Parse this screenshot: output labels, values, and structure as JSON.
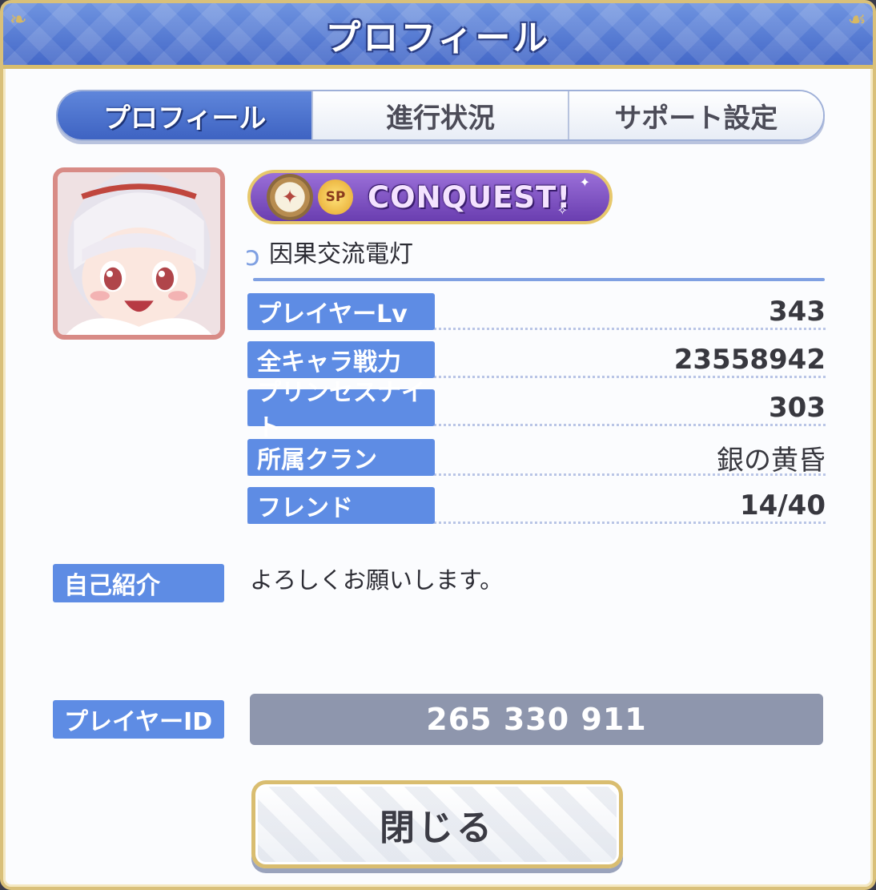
{
  "dialog": {
    "title": "プロフィール"
  },
  "tabs": [
    {
      "label": "プロフィール",
      "active": true
    },
    {
      "label": "進行状況",
      "active": false
    },
    {
      "label": "サポート設定",
      "active": false
    }
  ],
  "badge": {
    "sp_label": "SP",
    "text": "CONQUEST!"
  },
  "player": {
    "name": "因果交流電灯"
  },
  "stats": [
    {
      "label": "プレイヤーLv",
      "value": "343"
    },
    {
      "label": "全キャラ戦力",
      "value": "23558942"
    },
    {
      "label": "プリンセスナイト",
      "value": "303"
    },
    {
      "label": "所属クラン",
      "value": "銀の黄昏"
    },
    {
      "label": "フレンド",
      "value": "14/40"
    }
  ],
  "intro": {
    "label": "自己紹介",
    "text": "よろしくお願いします。"
  },
  "player_id": {
    "label": "プレイヤーID",
    "value": "265 330 911"
  },
  "close_button": {
    "label": "閉じる"
  },
  "colors": {
    "title_bar": "#4f74d0",
    "label_blue": "#5e8ce4",
    "gold_border": "#d9bd70",
    "id_box": "#8e96ad",
    "badge_purple": "#7d52c4"
  }
}
